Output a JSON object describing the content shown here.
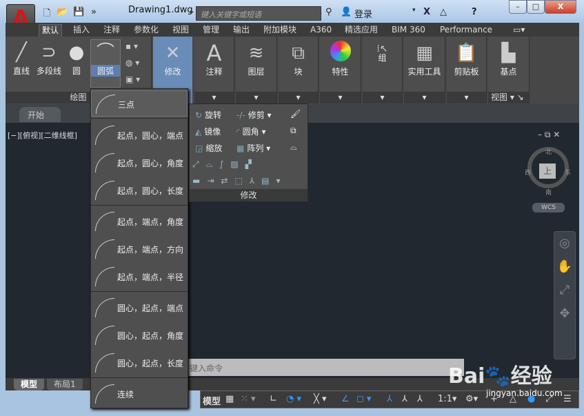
{
  "title": {
    "document": "Drawing1.dwg",
    "search_placeholder": "键入关键字或短语",
    "login": "登录"
  },
  "ribbon_tabs": [
    "默认",
    "插入",
    "注释",
    "参数化",
    "视图",
    "管理",
    "输出",
    "附加模块",
    "A360",
    "精选应用",
    "BIM 360",
    "Performance"
  ],
  "draw_panel": {
    "label": "绘图",
    "line": "直线",
    "polyline": "多段线",
    "circle": "圆",
    "arc": "圆弧"
  },
  "panels": {
    "modify": "修改",
    "annotation": "注释",
    "layers": "图层",
    "block": "块",
    "properties": "特性",
    "group": "组",
    "utilities": "实用工具",
    "clipboard": "剪贴板",
    "basepoint": "基点",
    "view": "视图"
  },
  "file_tab": "开始",
  "viewport_label": "[−][俯视][二维线框]",
  "arc_menu": [
    "三点",
    "起点，圆心，端点",
    "起点，圆心，角度",
    "起点，圆心，长度",
    "起点，端点，角度",
    "起点，端点，方向",
    "起点，端点，半径",
    "圆心，起点，端点",
    "圆心，起点，角度",
    "圆心，起点，长度",
    "连续"
  ],
  "modify_menu": {
    "items": [
      "旋转",
      "修剪",
      "镜像",
      "圆角",
      "缩放",
      "阵列"
    ],
    "label": "修改"
  },
  "viewcube": {
    "north": "北",
    "south": "南",
    "east": "东",
    "west": "西",
    "top": "上",
    "wcs": "WCS"
  },
  "command_placeholder": "键入命令",
  "layout_tabs": [
    "模型",
    "布局1"
  ],
  "status": {
    "model": "模型",
    "scale": "1:1"
  },
  "watermark": {
    "brand": "Bai经验",
    "url": "jingyan.baidu.com"
  }
}
